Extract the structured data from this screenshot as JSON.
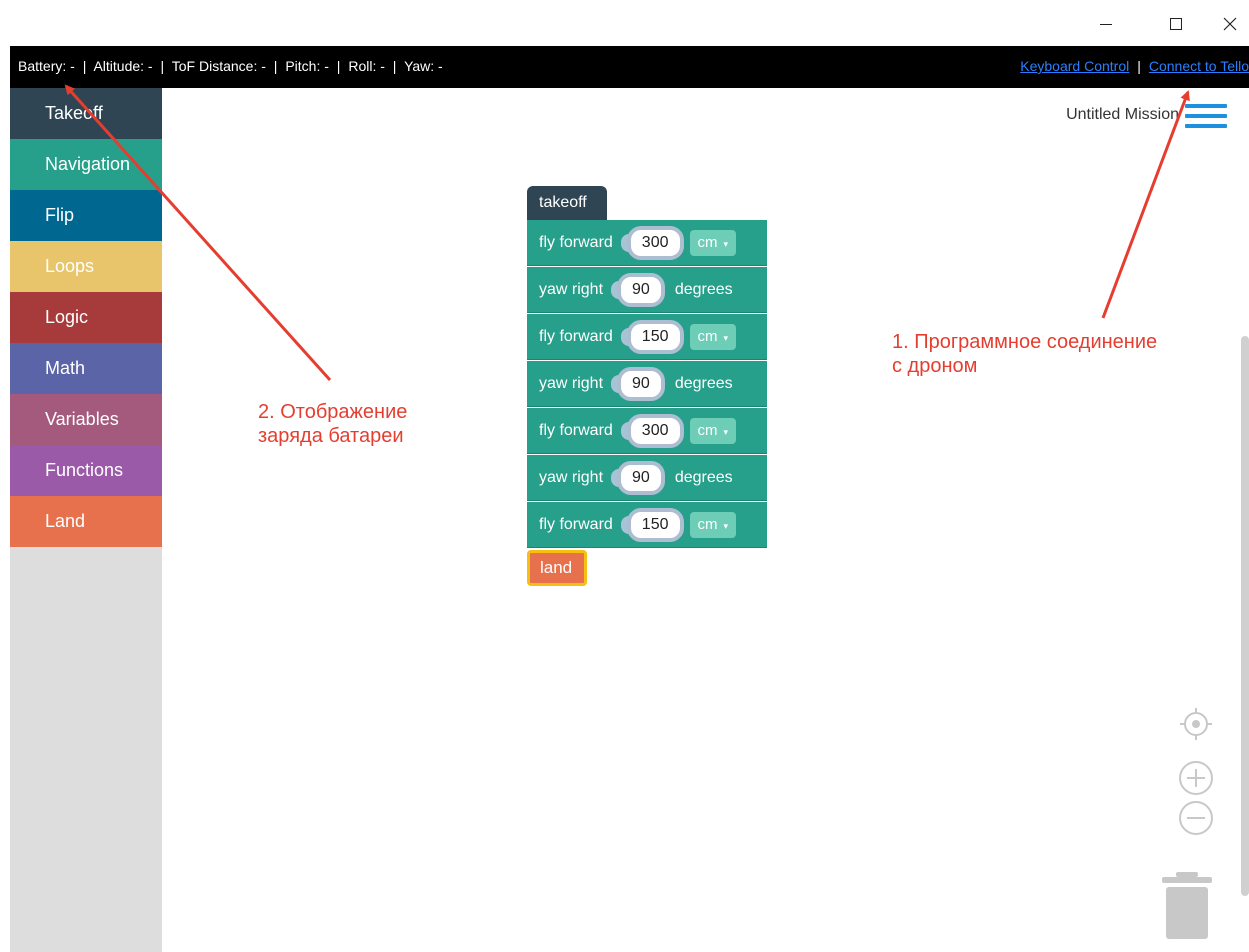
{
  "window": {
    "minimize_icon": "minimize-icon",
    "maximize_icon": "maximize-icon",
    "close_icon": "close-icon"
  },
  "status_bar": {
    "battery": "Battery: -",
    "altitude": "Altitude: -",
    "tof_distance": "ToF Distance: -",
    "pitch": "Pitch: -",
    "roll": "Roll: -",
    "yaw": "Yaw: -",
    "separator": "|",
    "keyboard_control": "Keyboard Control",
    "connect": "Connect to Tello",
    "link_color": "#2a7fff"
  },
  "sidebar": {
    "categories": [
      {
        "label": "Takeoff",
        "color": "#2f4553"
      },
      {
        "label": "Navigation",
        "color": "#26a08a"
      },
      {
        "label": "Flip",
        "color": "#006890"
      },
      {
        "label": "Loops",
        "color": "#e8c46a"
      },
      {
        "label": "Logic",
        "color": "#a73b3b"
      },
      {
        "label": "Math",
        "color": "#5b64a6"
      },
      {
        "label": "Variables",
        "color": "#a45a7d"
      },
      {
        "label": "Functions",
        "color": "#9a5aa8"
      },
      {
        "label": "Land",
        "color": "#e8714d"
      }
    ]
  },
  "workspace": {
    "mission_title": "Untitled Mission",
    "menu_icon": "hamburger-menu-icon"
  },
  "blocks": {
    "takeoff": "takeoff",
    "commands": [
      {
        "label": "fly forward",
        "value": "300",
        "unit": "cm"
      },
      {
        "label": "yaw right",
        "value": "90",
        "unit": "degrees"
      },
      {
        "label": "fly forward",
        "value": "150",
        "unit": "cm"
      },
      {
        "label": "yaw right",
        "value": "90",
        "unit": "degrees"
      },
      {
        "label": "fly forward",
        "value": "300",
        "unit": "cm"
      },
      {
        "label": "yaw right",
        "value": "90",
        "unit": "degrees"
      },
      {
        "label": "fly forward",
        "value": "150",
        "unit": "cm"
      }
    ],
    "land": "land",
    "dropdown_arrow": "▾"
  },
  "annotations": {
    "note1_line1": "1. Программное соединение",
    "note1_line2": "с дроном",
    "note2_line1": "2. Отображение",
    "note2_line2": "заряда батареи",
    "color": "#e53e30"
  },
  "controls": {
    "recenter_icon": "recenter-icon",
    "zoom_in_icon": "zoom-in-icon",
    "zoom_out_icon": "zoom-out-icon",
    "trash_icon": "trash-icon"
  }
}
